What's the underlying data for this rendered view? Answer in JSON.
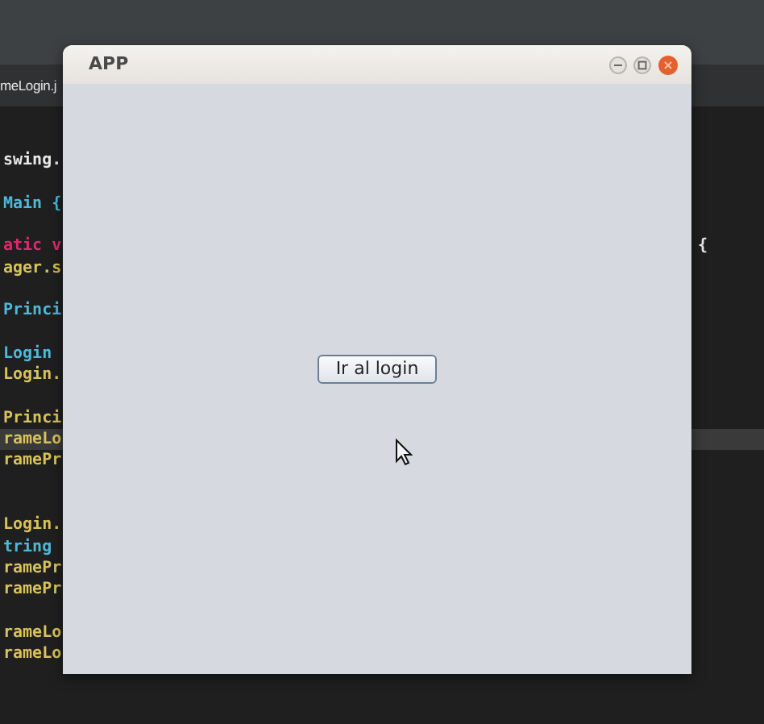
{
  "editor": {
    "tab": {
      "label": "meLogin.j",
      "selected": true
    },
    "lines": [
      {
        "kind": "blank"
      },
      {
        "kind": "code",
        "text": "swing.",
        "color": "#e8e8e8",
        "current": false
      },
      {
        "kind": "blank"
      },
      {
        "kind": "code",
        "text": "Main {",
        "color": "#4fb8d8",
        "current": false
      },
      {
        "kind": "blank"
      },
      {
        "kind": "code",
        "text": "atic v",
        "color": "#e0286e",
        "current": false,
        "tail": "{"
      },
      {
        "kind": "code",
        "text": "ager.s",
        "color": "#d8c25a",
        "current": false
      },
      {
        "kind": "blank"
      },
      {
        "kind": "code",
        "text": "Princi",
        "color": "#4fb8d8",
        "current": false
      },
      {
        "kind": "blank"
      },
      {
        "kind": "code",
        "text": "Login",
        "color": "#4fb8d8",
        "current": false
      },
      {
        "kind": "code",
        "text": "Login.",
        "color": "#d8c25a",
        "current": false
      },
      {
        "kind": "blank"
      },
      {
        "kind": "code",
        "text": "Princi",
        "color": "#d8c25a",
        "current": false
      },
      {
        "kind": "code",
        "text": "rameLo",
        "color": "#d8c25a",
        "current": true
      },
      {
        "kind": "code",
        "text": "ramePr",
        "color": "#d8c25a",
        "current": false
      },
      {
        "kind": "blank"
      },
      {
        "kind": "blank"
      },
      {
        "kind": "code",
        "text": "Login.",
        "color": "#d8c25a",
        "current": false
      },
      {
        "kind": "code",
        "text": "tring",
        "color": "#4fb8d8",
        "current": false
      },
      {
        "kind": "code",
        "text": "ramePr",
        "color": "#d8c25a",
        "current": false
      },
      {
        "kind": "code",
        "text": "ramePr",
        "color": "#d8c25a",
        "current": false
      },
      {
        "kind": "blank"
      },
      {
        "kind": "code",
        "text": "rameLo",
        "color": "#d8c25a",
        "current": false
      },
      {
        "kind": "code",
        "text": "rameLo",
        "color": "#d8c25a",
        "current": false
      }
    ]
  },
  "window": {
    "title": "APP",
    "button": {
      "label": "Ir al login"
    }
  }
}
